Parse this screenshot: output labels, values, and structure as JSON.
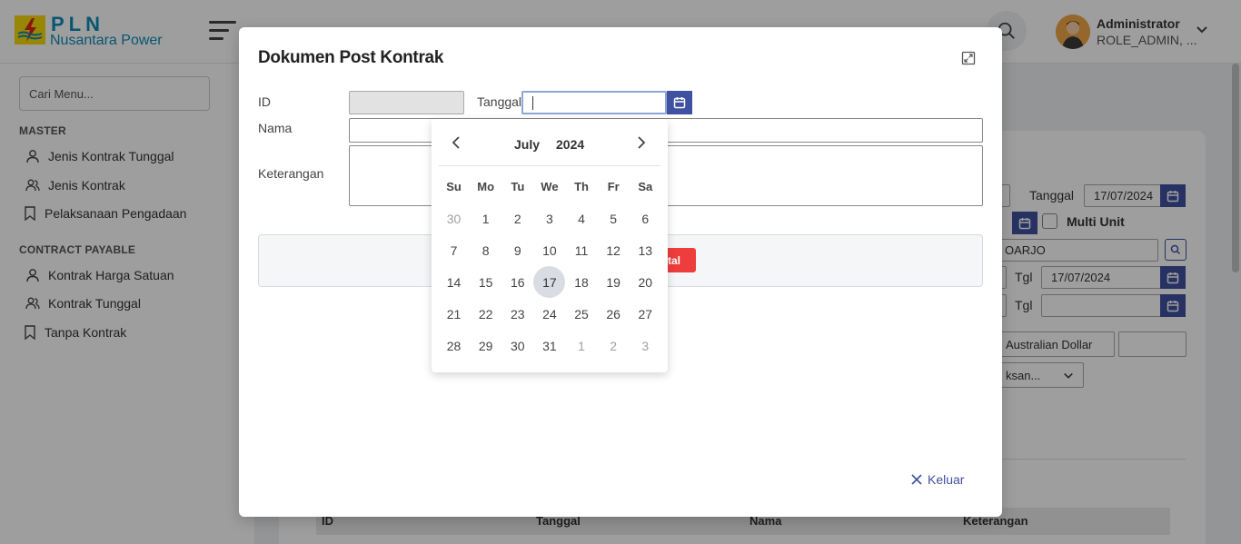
{
  "app": {
    "brand_line1": "PLN",
    "brand_line2": "Nusantara Power",
    "user_name": "Administrator",
    "user_role": "ROLE_ADMIN, ..."
  },
  "sidebar": {
    "search_placeholder": "Cari Menu...",
    "section_master": "MASTER",
    "master_items": [
      {
        "label": "Jenis Kontrak Tunggal",
        "icon": "user-icon"
      },
      {
        "label": "Jenis Kontrak",
        "icon": "users-icon"
      },
      {
        "label": "Pelaksanaan Pengadaan",
        "icon": "bookmark-icon"
      }
    ],
    "section_payable": "CONTRACT PAYABLE",
    "payable_items": [
      {
        "label": "Kontrak Harga Satuan",
        "icon": "user-icon"
      },
      {
        "label": "Kontrak Tunggal",
        "icon": "users-icon"
      },
      {
        "label": "Tanpa Kontrak",
        "icon": "bookmark-icon"
      }
    ]
  },
  "background_form": {
    "tanggal_label": "Tanggal",
    "tanggal_value": "17/07/2024",
    "multi_unit_label": "Multi Unit",
    "location_value": "OARJO",
    "tgl_label_1": "Tgl",
    "tgl_value_1": "17/07/2024",
    "tgl_label_2": "Tgl",
    "tgl_value_2": "",
    "currency_value": "Australian Dollar",
    "select_value": "ksan...",
    "table_headers": [
      "ID",
      "Tanggal",
      "Nama",
      "Keterangan"
    ]
  },
  "modal": {
    "title": "Dokumen Post Kontrak",
    "id_label": "ID",
    "id_value": "",
    "tanggal_label": "Tanggal",
    "tanggal_value": "",
    "nama_label": "Nama",
    "nama_value": "",
    "keterangan_label": "Keterangan",
    "keterangan_value": "",
    "red_button_label": "tal",
    "close_label": "Keluar"
  },
  "datepicker": {
    "month": "July",
    "year": "2024",
    "weekdays": [
      "Su",
      "Mo",
      "Tu",
      "We",
      "Th",
      "Fr",
      "Sa"
    ],
    "days": [
      {
        "d": "30",
        "other": true
      },
      {
        "d": "1"
      },
      {
        "d": "2"
      },
      {
        "d": "3"
      },
      {
        "d": "4"
      },
      {
        "d": "5"
      },
      {
        "d": "6"
      },
      {
        "d": "7"
      },
      {
        "d": "8"
      },
      {
        "d": "9"
      },
      {
        "d": "10"
      },
      {
        "d": "11"
      },
      {
        "d": "12"
      },
      {
        "d": "13"
      },
      {
        "d": "14"
      },
      {
        "d": "15"
      },
      {
        "d": "16"
      },
      {
        "d": "17",
        "today": true
      },
      {
        "d": "18"
      },
      {
        "d": "19"
      },
      {
        "d": "20"
      },
      {
        "d": "21"
      },
      {
        "d": "22"
      },
      {
        "d": "23"
      },
      {
        "d": "24"
      },
      {
        "d": "25"
      },
      {
        "d": "26"
      },
      {
        "d": "27"
      },
      {
        "d": "28"
      },
      {
        "d": "29"
      },
      {
        "d": "30"
      },
      {
        "d": "31"
      },
      {
        "d": "1",
        "other": true
      },
      {
        "d": "2",
        "other": true
      },
      {
        "d": "3",
        "other": true
      }
    ]
  },
  "colors": {
    "primary": "#3f51a0",
    "brand": "#0d8bb8",
    "danger": "#ee3d3d"
  }
}
